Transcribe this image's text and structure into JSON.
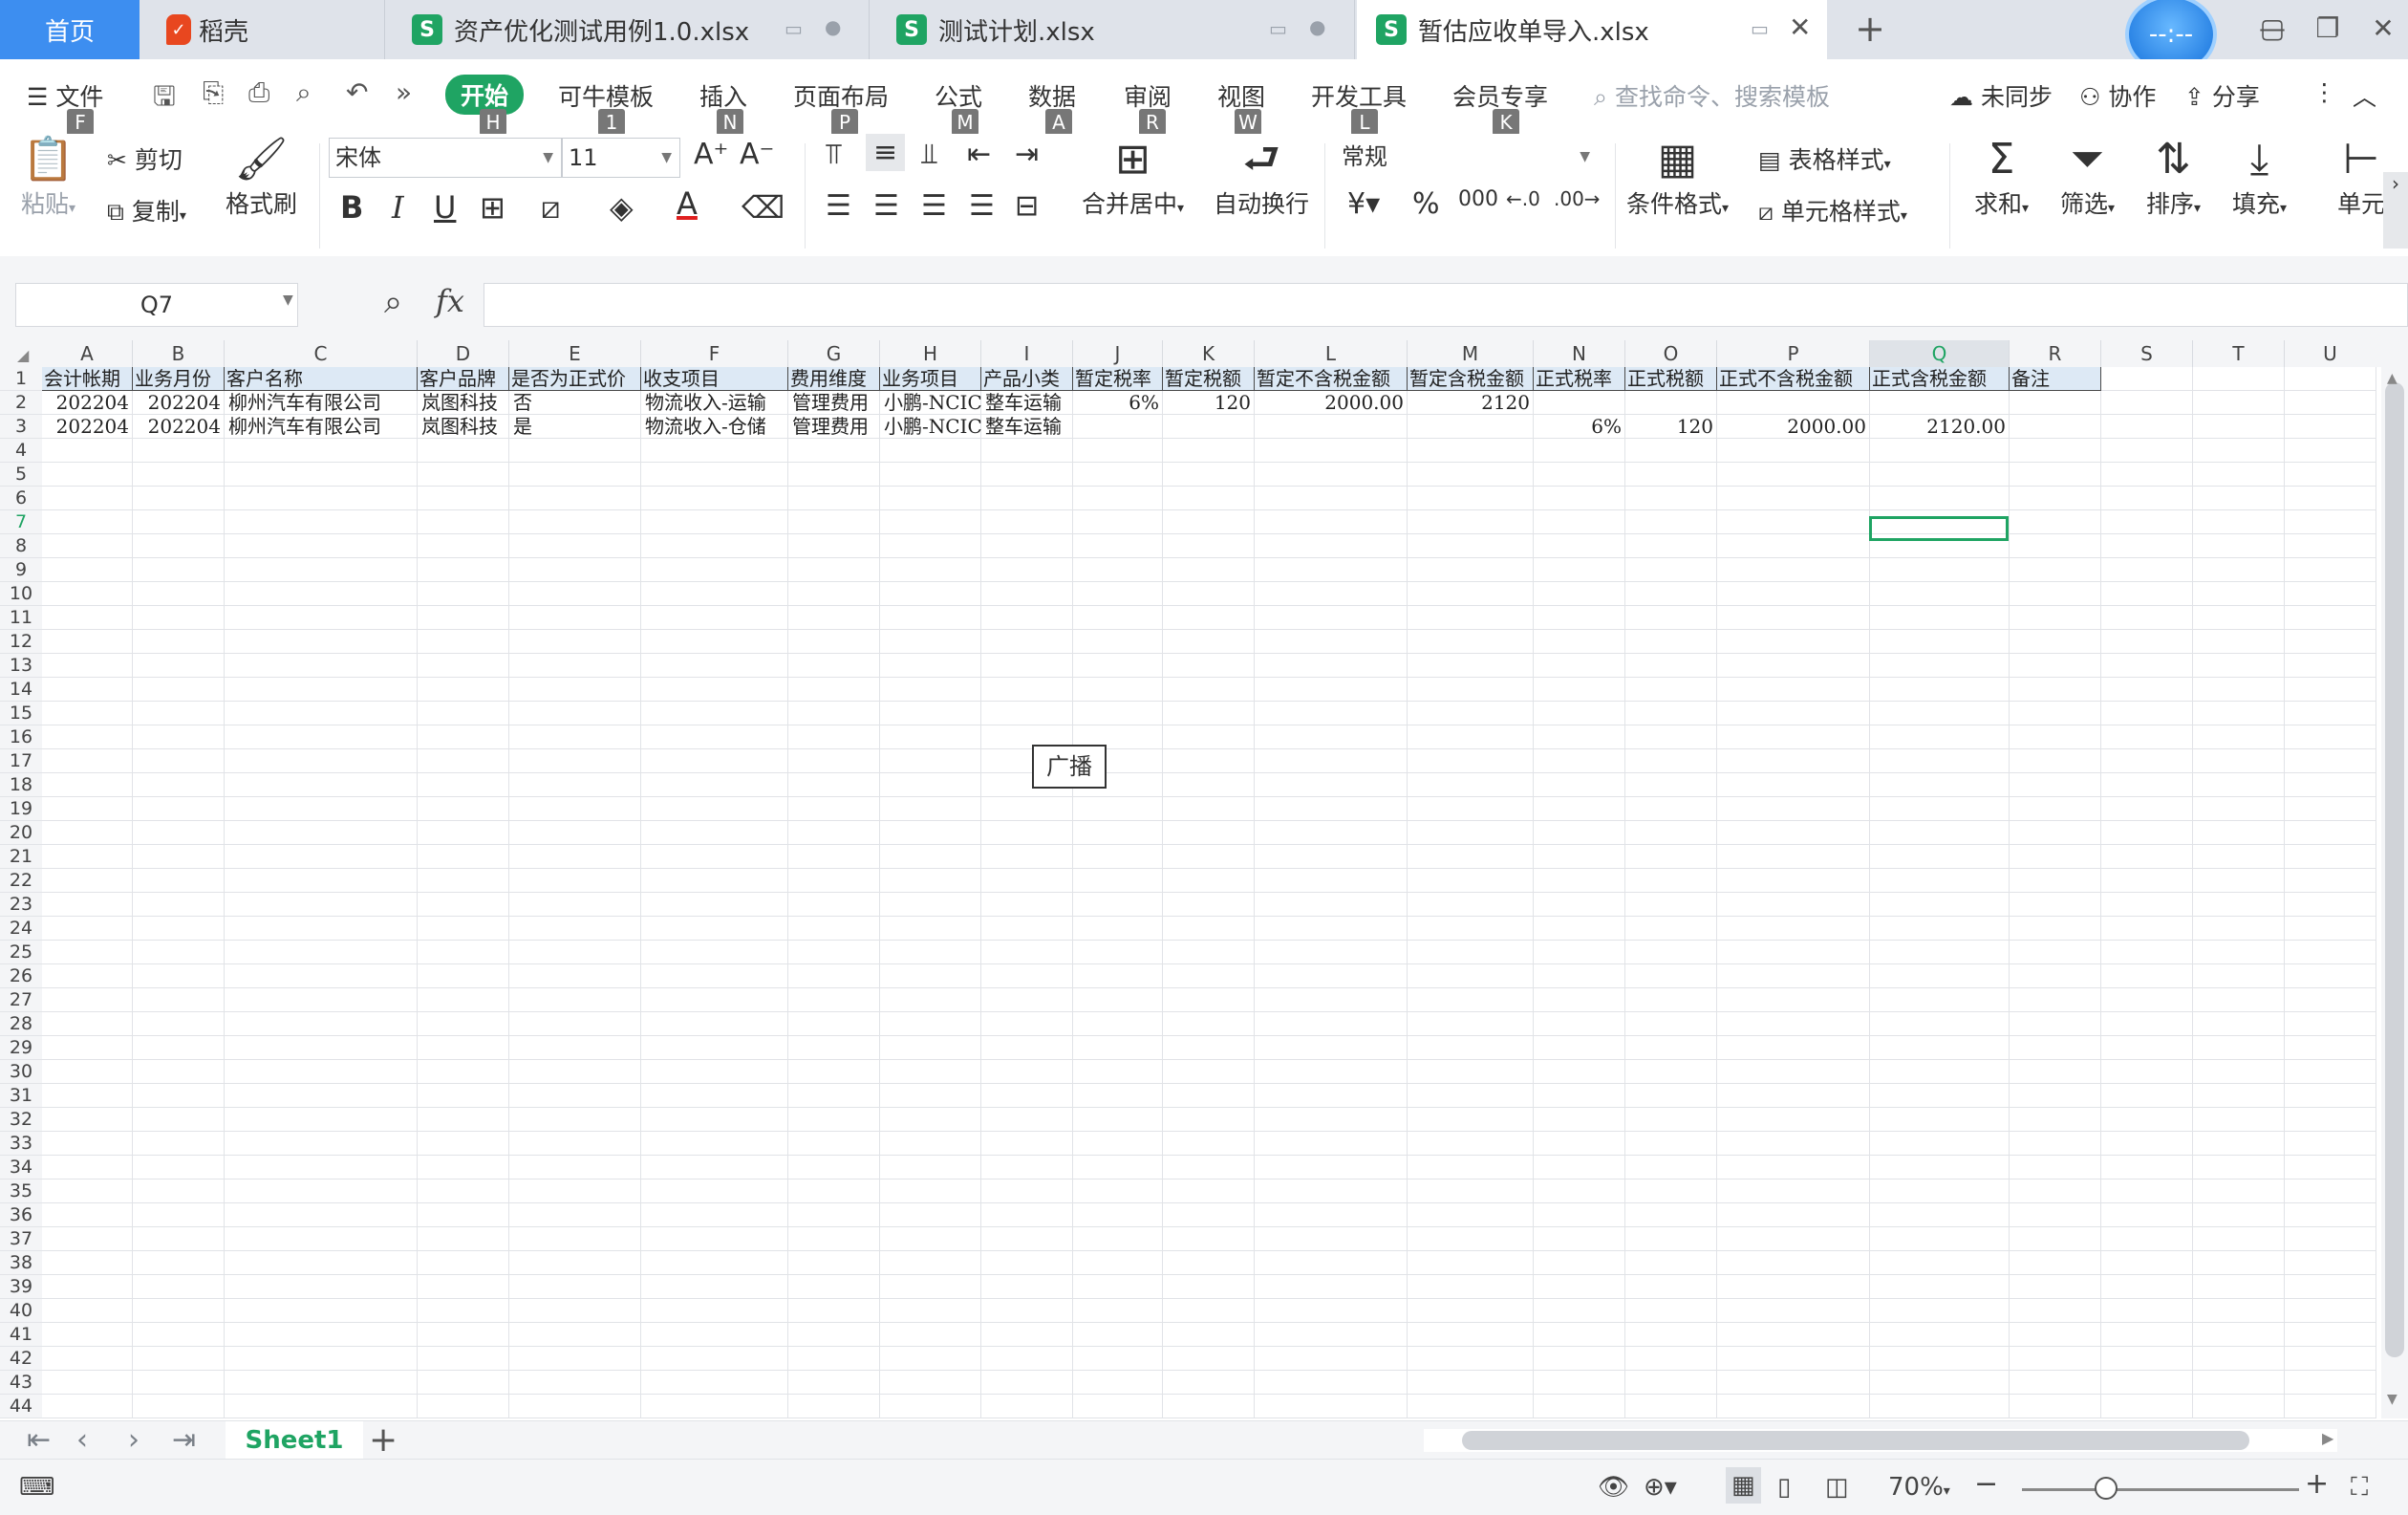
{
  "tabs": {
    "home": "首页",
    "docer": "稻壳",
    "file1": "资产优化测试用例1.0.xlsx",
    "file2": "测试计划.xlsx",
    "file3": "暂估应收单导入.xlsx",
    "xlsx_badge": "S",
    "avatar_text": "--:--"
  },
  "menu": {
    "file": "文件",
    "items": [
      "开始",
      "可牛模板",
      "插入",
      "页面布局",
      "公式",
      "数据",
      "审阅",
      "视图",
      "开发工具",
      "会员专享"
    ],
    "keys": [
      "F",
      "H",
      "1",
      "N",
      "P",
      "M",
      "A",
      "R",
      "W",
      "L",
      "K"
    ],
    "search_placeholder": "查找命令、搜索模板",
    "unsynced": "未同步",
    "collaborate": "协作",
    "share": "分享"
  },
  "ribbon": {
    "paste": "粘贴",
    "cut": "剪切",
    "copy": "复制",
    "format_painter": "格式刷",
    "font_name": "宋体",
    "font_size": "11",
    "merge_center": "合并居中",
    "wrap_text": "自动换行",
    "number_format": "常规",
    "conditional_format": "条件格式",
    "table_style": "表格样式",
    "cell_style": "单元格样式",
    "sum": "求和",
    "filter": "筛选",
    "sort": "排序",
    "fill": "填充",
    "cell": "单元"
  },
  "formula_bar": {
    "name_box": "Q7",
    "fx": "fx",
    "value": ""
  },
  "grid": {
    "columns": [
      "A",
      "B",
      "C",
      "D",
      "E",
      "F",
      "G",
      "H",
      "I",
      "J",
      "K",
      "L",
      "M",
      "N",
      "O",
      "P",
      "Q",
      "R",
      "S",
      "T",
      "U"
    ],
    "selected_column": "Q",
    "selected_row": 7,
    "row_count": 44,
    "header_row": [
      "会计帐期",
      "业务月份",
      "客户名称",
      "客户品牌",
      "是否为正式价",
      "收支项目",
      "费用维度",
      "业务项目",
      "产品小类",
      "暂定税率",
      "暂定税额",
      "暂定不含税金额",
      "暂定含税金额",
      "正式税率",
      "正式税额",
      "正式不含税金额",
      "正式含税金额",
      "备注"
    ],
    "rows": [
      [
        "202204",
        "202204",
        "柳州汽车有限公司",
        "岚图科技",
        "否",
        "物流收入-运输",
        "管理费用",
        "小鹏-NCIC",
        "整车运输",
        "6%",
        "120",
        "2000.00",
        "2120",
        "",
        "",
        "",
        "",
        ""
      ],
      [
        "202204",
        "202204",
        "柳州汽车有限公司",
        "岚图科技",
        "是",
        "物流收入-仓储",
        "管理费用",
        "小鹏-NCIC",
        "整车运输",
        "",
        "",
        "",
        "",
        "6%",
        "120",
        "2000.00",
        "2120.00",
        ""
      ]
    ],
    "floating_button": "广播"
  },
  "sheets": {
    "active": "Sheet1"
  },
  "status": {
    "zoom": "70%"
  },
  "colors": {
    "accent": "#1fa463",
    "header_fill": "#dde9f5",
    "home_tab": "#3d8ef0"
  }
}
